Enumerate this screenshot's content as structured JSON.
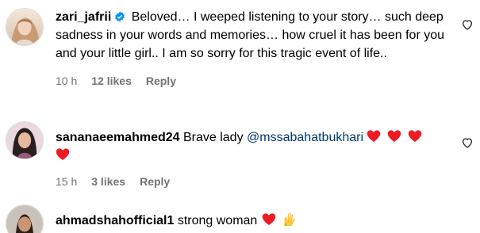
{
  "comments": [
    {
      "username": "zari_jafrii",
      "verified": true,
      "text": "Beloved… I weeped listening to your story… such deep sadness in your words and memories… how cruel it has been for you and your little girl.. I am so sorry for this tragic event of life..",
      "time": "10 h",
      "likes": "12 likes",
      "reply": "Reply",
      "avatar_icon": "avatar-photo"
    },
    {
      "username": "sananaeemahmed24",
      "verified": false,
      "text": "Brave lady",
      "mention": "@mssabahatbukhari",
      "emojis": "red-heart x4",
      "time": "15 h",
      "likes": "3 likes",
      "reply": "Reply",
      "avatar_icon": "avatar-photo"
    },
    {
      "username": "ahmadshahofficial1",
      "verified": false,
      "text": "strong woman",
      "emojis": "red-heart, raising-hands",
      "avatar_icon": "avatar-photo"
    }
  ],
  "colors": {
    "text": "#000000",
    "meta": "#737373",
    "mention": "#00376b",
    "verified": "#0095f6",
    "heart": "#ed1c24"
  }
}
